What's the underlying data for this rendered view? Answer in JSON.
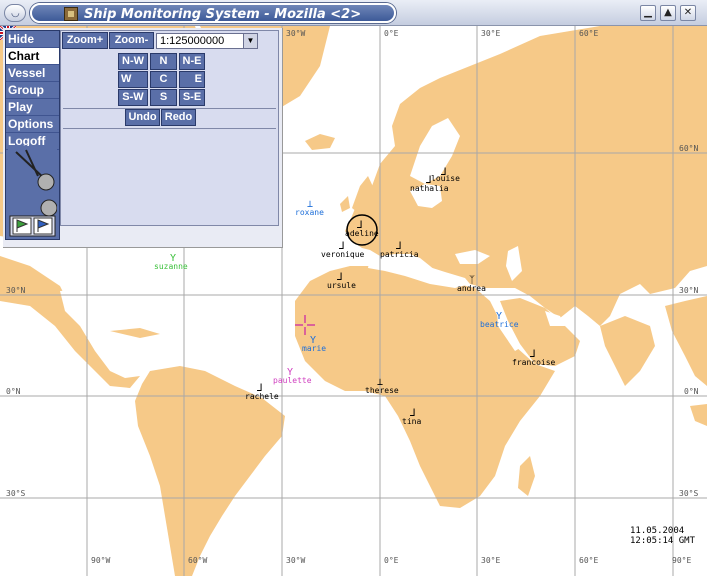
{
  "window": {
    "title": "Ship Monitoring System - Mozilla <2>",
    "menu_glyph": "◡",
    "buttons": [
      {
        "name": "minimize",
        "glyph": "▁"
      },
      {
        "name": "maximize",
        "glyph": "▲"
      },
      {
        "name": "close",
        "glyph": "✕"
      }
    ]
  },
  "sidebar": {
    "items": [
      {
        "label": "Hide",
        "active": false
      },
      {
        "label": "Chart",
        "active": true
      },
      {
        "label": "Vessel",
        "active": false
      },
      {
        "label": "Group",
        "active": false
      },
      {
        "label": "Play",
        "active": false
      },
      {
        "label": "Options",
        "active": false
      },
      {
        "label": "Logoff",
        "active": false
      }
    ]
  },
  "panel": {
    "zoom_in": "Zoom+",
    "zoom_out": "Zoom-",
    "scale": "1:125000000",
    "dirs": [
      "N-W",
      "N",
      "N-E",
      "W",
      "C",
      "E",
      "S-W",
      "S",
      "S-E"
    ],
    "undo": "Undo",
    "redo": "Redo"
  },
  "map": {
    "top_labels": [
      "30°W",
      "0°E",
      "30°E",
      "60°E"
    ],
    "bottom_labels": [
      "90°W",
      "60°W",
      "30°W",
      "0°E",
      "30°E",
      "60°E",
      "90°E"
    ],
    "right_labels": [
      "60°N",
      "30°N",
      "0°N",
      "30°S"
    ],
    "left_labels": [
      "30°N",
      "0°N",
      "30°S"
    ],
    "date": "11.05.2004",
    "time": "12:05:14 GMT",
    "ships": [
      {
        "name": "louise",
        "color": "#000000"
      },
      {
        "name": "nathalia",
        "color": "#000000"
      },
      {
        "name": "roxane",
        "color": "#1e6fd9"
      },
      {
        "name": "adeline",
        "color": "#000000"
      },
      {
        "name": "veronique",
        "color": "#000000"
      },
      {
        "name": "patricia",
        "color": "#000000"
      },
      {
        "name": "suzanne",
        "color": "#3cc03c"
      },
      {
        "name": "ursule",
        "color": "#000000"
      },
      {
        "name": "andrea",
        "color": "#000000"
      },
      {
        "name": "beatrice",
        "color": "#1e6fd9"
      },
      {
        "name": "marie",
        "color": "#1e6fd9"
      },
      {
        "name": "francoise",
        "color": "#000000"
      },
      {
        "name": "paulette",
        "color": "#d040c0"
      },
      {
        "name": "rachele",
        "color": "#000000"
      },
      {
        "name": "therese",
        "color": "#000000"
      },
      {
        "name": "tina",
        "color": "#000000"
      }
    ]
  },
  "colors": {
    "land": "#f6c988",
    "sea": "#ffffff",
    "grid": "#a8a8a8",
    "panel_button": "#5a6fa8"
  }
}
